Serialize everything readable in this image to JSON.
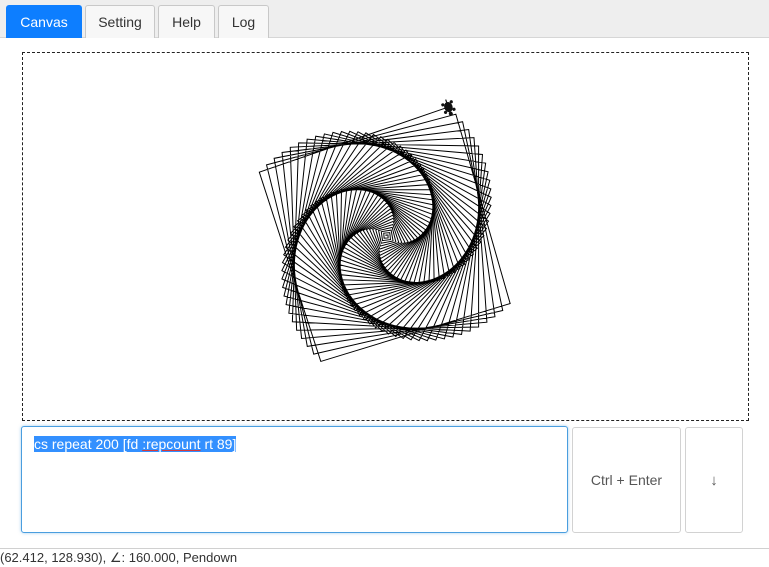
{
  "tabs": [
    {
      "label": "Canvas",
      "active": true
    },
    {
      "label": "Setting",
      "active": false
    },
    {
      "label": "Help",
      "active": false
    },
    {
      "label": "Log",
      "active": false
    }
  ],
  "editor": {
    "code_prefix": "cs repeat 200 [fd ",
    "code_var": ":repcount",
    "code_suffix": " rt 89]"
  },
  "buttons": {
    "run_label": "Ctrl + Enter",
    "more_label": "↓"
  },
  "status": {
    "text": "(62.412, 128.930), ∠: 160.000, Pendown"
  },
  "drawing": {
    "repeat": 200,
    "turn_deg": 89,
    "pen_color": "#000000"
  },
  "theme": {
    "accent": "#0d7eff"
  }
}
